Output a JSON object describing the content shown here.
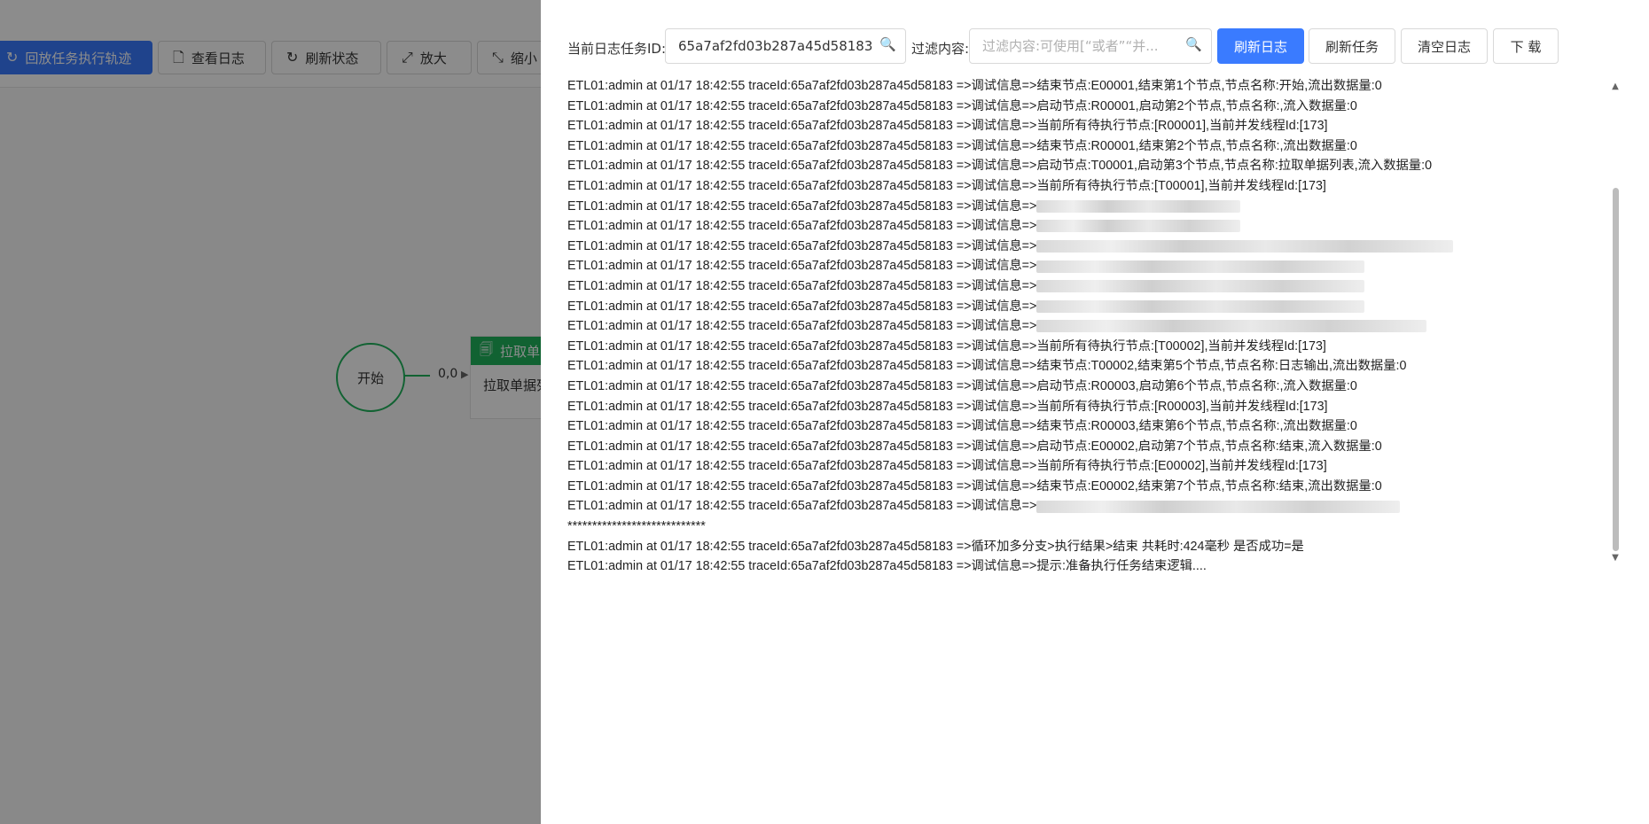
{
  "editor": {
    "toolbar": [
      {
        "label": "回放任务执行轨迹",
        "icon": "replay-icon",
        "glyph": "↻",
        "primary": true
      },
      {
        "label": "查看日志",
        "icon": "document-icon",
        "glyph": "🗋",
        "primary": false
      },
      {
        "label": "刷新状态",
        "icon": "refresh-icon",
        "glyph": "↻",
        "primary": false
      },
      {
        "label": "放大",
        "icon": "expand-icon",
        "glyph": "⤢",
        "primary": false
      },
      {
        "label": "缩小",
        "icon": "shrink-icon",
        "glyph": "⤡",
        "primary": false
      }
    ],
    "start_node": "开始",
    "edge_label": "0,0",
    "task_node": {
      "title": "拉取单",
      "body": "拉取单据列"
    }
  },
  "drawer": {
    "task_id_label": "当前日志任务ID:",
    "task_id_value": "65a7af2fd03b287a45d58183",
    "filter_label": "过滤内容:",
    "filter_placeholder": "过滤内容:可使用[“或者”“并...",
    "buttons": {
      "refresh_log": "刷新日志",
      "refresh_task": "刷新任务",
      "clear_log": "清空日志",
      "download": "下 载"
    }
  },
  "log": {
    "prefix": "ETL01:admin at 01/17 18:42:55 traceId:65a7af2fd03b287a45d58183 =>",
    "lines": [
      "调试信息=>结束节点:E00001,结束第1个节点,节点名称:开始,流出数据量:0",
      "调试信息=>启动节点:R00001,启动第2个节点,节点名称:,流入数据量:0",
      "调试信息=>当前所有待执行节点:[R00001],当前并发线程Id:[173]",
      "调试信息=>结束节点:R00001,结束第2个节点,节点名称:,流出数据量:0",
      "调试信息=>启动节点:T00001,启动第3个节点,节点名称:拉取单据列表,流入数据量:0",
      "调试信息=>当前所有待执行节点:[T00001],当前并发线程Id:[173]",
      "调试信息=>",
      "调试信息=>",
      "调试信息=>",
      "调试信息=>",
      "调试信息=>",
      "调试信息=>",
      "调试信息=>",
      "调试信息=>当前所有待执行节点:[T00002],当前并发线程Id:[173]",
      "调试信息=>结束节点:T00002,结束第5个节点,节点名称:日志输出,流出数据量:0",
      "调试信息=>启动节点:R00003,启动第6个节点,节点名称:,流入数据量:0",
      "调试信息=>当前所有待执行节点:[R00003],当前并发线程Id:[173]",
      "调试信息=>结束节点:R00003,结束第6个节点,节点名称:,流出数据量:0",
      "调试信息=>启动节点:E00002,启动第7个节点,节点名称:结束,流入数据量:0",
      "调试信息=>当前所有待执行节点:[E00002],当前并发线程Id:[173]",
      "调试信息=>结束节点:E00002,结束第7个节点,节点名称:结束,流出数据量:0",
      "调试信息=>"
    ],
    "separator": "****************************",
    "tail": [
      "ETL01:admin at 01/17 18:42:55 traceId:65a7af2fd03b287a45d58183 =>循环加多分支>执行结果>结束 共耗时:424毫秒 是否成功=是",
      "ETL01:admin at 01/17 18:42:55 traceId:65a7af2fd03b287a45d58183 =>调试信息=>提示:准备执行任务结束逻辑...."
    ]
  },
  "icons": {
    "search": "search-icon",
    "scroll_up": "caret-up-icon",
    "scroll_down": "caret-down-icon",
    "task_node": "document-icon"
  },
  "colors": {
    "primary": "#3a7bff",
    "node_green": "#1fb35c",
    "overlay": "rgba(0,0,0,0.45)"
  }
}
